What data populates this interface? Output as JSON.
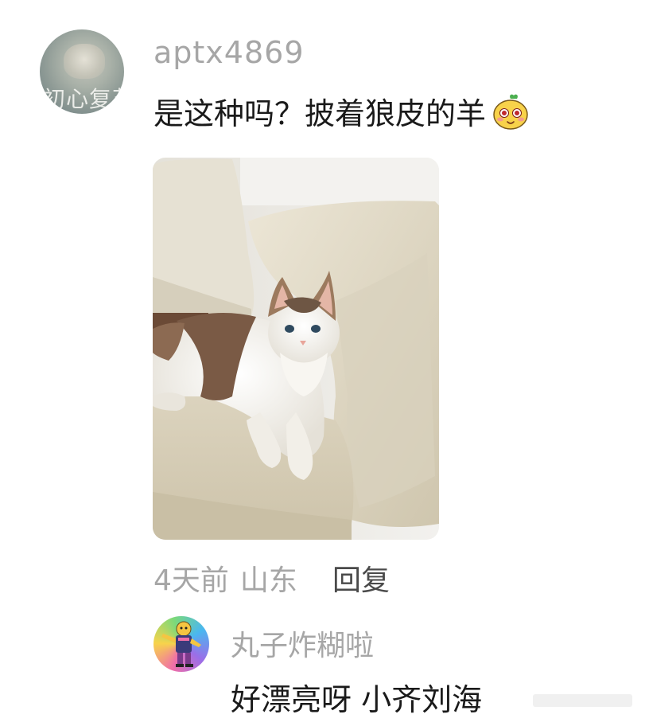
{
  "comment": {
    "avatar_text": "初心复苏",
    "username": "aptx4869",
    "text": "是这种吗？披着狼皮的羊",
    "emoji": "blushing-emoji",
    "image_alt": "白色与棕色相间的长毛猫趴在米色沙发上",
    "time": "4天前",
    "location": "山东",
    "reply_label": "回复"
  },
  "reply": {
    "username": "丸子炸糊啦",
    "text": "好漂亮呀 小齐刘海"
  },
  "colors": {
    "username_gray": "#a6a6a6",
    "text_dark": "#1a1a1a",
    "reply_dark": "#4a4a4a"
  }
}
